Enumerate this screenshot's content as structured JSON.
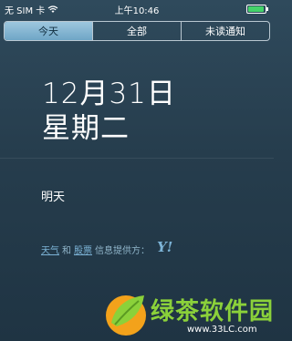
{
  "status_bar": {
    "carrier": "无 SIM 卡",
    "time": "上午10:46"
  },
  "tabs": [
    {
      "label": "今天",
      "selected": true
    },
    {
      "label": "全部",
      "selected": false
    },
    {
      "label": "未读通知",
      "selected": false
    }
  ],
  "today": {
    "date": "12月31日",
    "weekday": "星期二"
  },
  "tomorrow": {
    "label": "明天"
  },
  "provider": {
    "weather": "天气",
    "and": "和",
    "stocks": "股票",
    "suffix": "信息提供方：",
    "logo_text": "Y!"
  },
  "watermark": {
    "title": "绿茶软件园",
    "url": "www.33LC.com"
  },
  "colors": {
    "accent": "#7cb3d6",
    "watermark_green": "#8bd13a",
    "selected_tab": "#8fc0dc"
  }
}
